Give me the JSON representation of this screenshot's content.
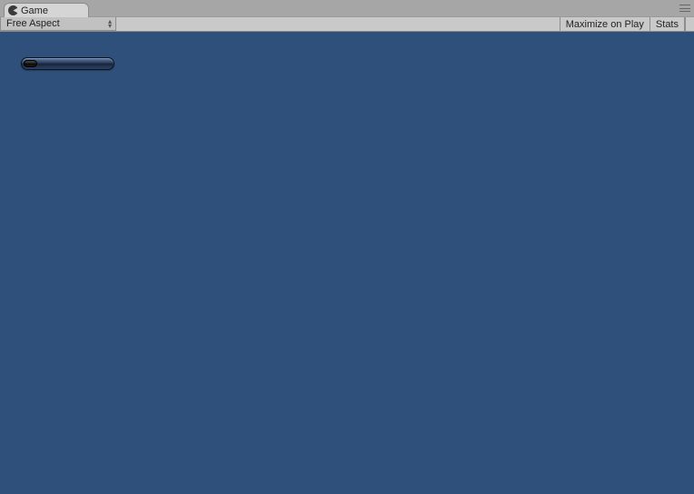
{
  "tab": {
    "label": "Game"
  },
  "toolbar": {
    "aspect_label": "Free Aspect",
    "maximize_label": "Maximize on Play",
    "stats_label": "Stats"
  },
  "progress": {
    "percent": 15
  },
  "colors": {
    "game_bg": "#2f507a"
  }
}
